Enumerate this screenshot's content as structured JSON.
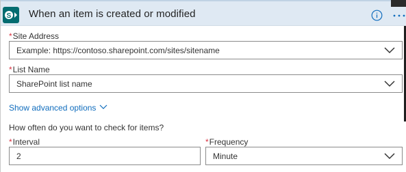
{
  "header": {
    "title": "When an item is created or modified",
    "logo_icon": "sharepoint-icon",
    "info_icon": "info-icon",
    "more_icon": "more-options-icon"
  },
  "fields": {
    "site_address": {
      "label": "Site Address",
      "placeholder": "Example: https://contoso.sharepoint.com/sites/sitename"
    },
    "list_name": {
      "label": "List Name",
      "placeholder": "SharePoint list name"
    },
    "advanced_link": "Show advanced options",
    "question": "How often do you want to check for items?",
    "interval": {
      "label": "Interval",
      "value": "2"
    },
    "frequency": {
      "label": "Frequency",
      "value": "Minute"
    }
  },
  "required_marker": "*",
  "colors": {
    "header_bg": "#dfe9f3",
    "link": "#0f6cbd",
    "required": "#d9303f",
    "sharepoint": "#036c70"
  }
}
